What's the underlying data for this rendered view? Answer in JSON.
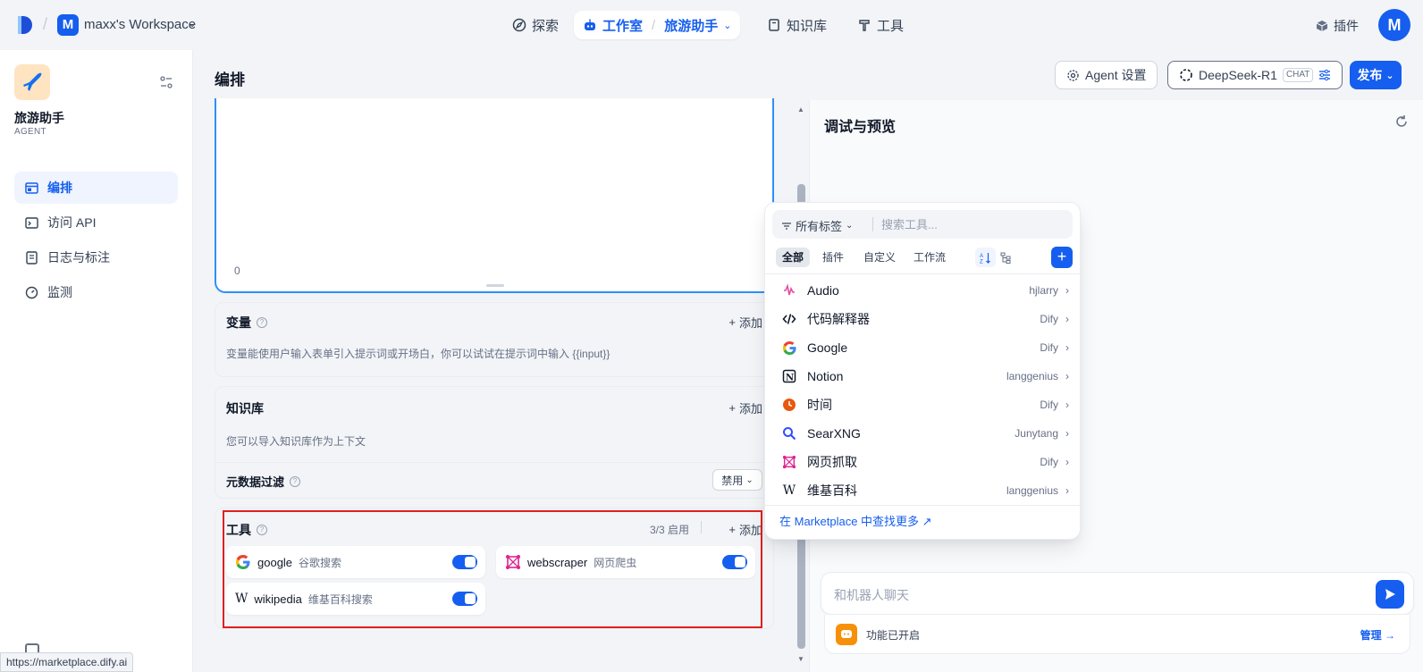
{
  "topbar": {
    "workspace_initial": "M",
    "workspace_name": "maxx's Workspace",
    "nav": {
      "explore": "探索",
      "studio": "工作室",
      "current_app": "旅游助手",
      "knowledge": "知识库",
      "tools": "工具"
    },
    "plugins": "插件",
    "user_initial": "M"
  },
  "sidebar": {
    "app_name": "旅游助手",
    "app_type": "AGENT",
    "items": [
      {
        "label": "编排",
        "icon": "layout-icon"
      },
      {
        "label": "访问 API",
        "icon": "terminal-icon"
      },
      {
        "label": "日志与标注",
        "icon": "file-list-icon"
      },
      {
        "label": "监测",
        "icon": "gauge-icon"
      }
    ]
  },
  "header": {
    "title": "编排",
    "agent_settings": "Agent 设置",
    "model_name": "DeepSeek-R1",
    "model_tag": "CHAT",
    "publish": "发布"
  },
  "prompt": {
    "char_count": "0"
  },
  "variables": {
    "title": "变量",
    "add": "添加",
    "description": "变量能使用户输入表单引入提示词或开场白，你可以试试在提示词中输入 {{input}}"
  },
  "knowledge": {
    "title": "知识库",
    "add": "添加",
    "description": "您可以导入知识库作为上下文",
    "metadata_filter": "元数据过滤",
    "metadata_filter_value": "禁用"
  },
  "tools": {
    "title": "工具",
    "enabled_count": "3/3 启用",
    "add": "添加",
    "items": [
      {
        "name": "google",
        "desc": "谷歌搜索",
        "enabled": true
      },
      {
        "name": "webscraper",
        "desc": "网页爬虫",
        "enabled": true
      },
      {
        "name": "wikipedia",
        "desc": "维基百科搜索",
        "enabled": true
      }
    ]
  },
  "preview": {
    "title": "调试与预览",
    "chat_placeholder": "和机器人聊天",
    "features_enabled": "功能已开启",
    "manage": "管理"
  },
  "tool_picker": {
    "filter_label": "所有标签",
    "search_placeholder": "搜索工具...",
    "tabs": [
      "全部",
      "插件",
      "自定义",
      "工作流"
    ],
    "items": [
      {
        "label": "Audio",
        "author": "hjlarry",
        "icon": "audio-icon"
      },
      {
        "label": "代码解释器",
        "author": "Dify",
        "icon": "code-icon"
      },
      {
        "label": "Google",
        "author": "Dify",
        "icon": "google-icon"
      },
      {
        "label": "Notion",
        "author": "langgenius",
        "icon": "notion-icon"
      },
      {
        "label": "时间",
        "author": "Dify",
        "icon": "clock-icon"
      },
      {
        "label": "SearXNG",
        "author": "Junytang",
        "icon": "searxng-icon"
      },
      {
        "label": "网页抓取",
        "author": "Dify",
        "icon": "webscraper-icon"
      },
      {
        "label": "维基百科",
        "author": "langgenius",
        "icon": "wikipedia-icon"
      }
    ],
    "footer": "在 Marketplace 中查找更多 ↗"
  },
  "status_url": "https://marketplace.dify.ai",
  "colors": {
    "accent": "#155eef",
    "highlight_frame": "#e0201e"
  }
}
